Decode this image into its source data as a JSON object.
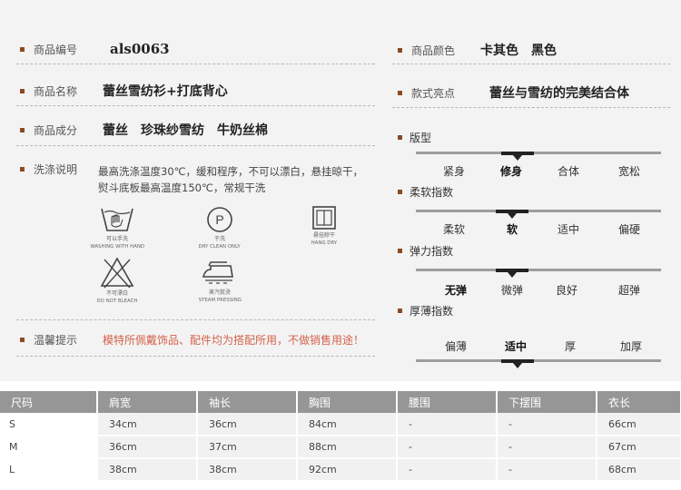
{
  "left": {
    "code": {
      "label": "商品编号",
      "value": "als0063"
    },
    "name": {
      "label": "商品名称",
      "value": "蕾丝雪纺衫+打底背心"
    },
    "material": {
      "label": "商品成分",
      "values": [
        "蕾丝",
        "珍珠纱雪纺",
        "牛奶丝棉"
      ]
    },
    "wash": {
      "label": "洗涤说明",
      "line1": "最高洗涤温度30℃，缓和程序，不可以漂白，悬挂晾干，",
      "line2": "熨斗底板最高温度150℃，常规干洗"
    },
    "warm": {
      "label": "温馨提示",
      "text": "模特所佩戴饰品、配件均为搭配所用，不做销售用途！"
    }
  },
  "care_icons": [
    {
      "icon": "hand-wash-icon",
      "cn": "可以手洗",
      "en": "WASHING WITH HAND"
    },
    {
      "icon": "dry-clean-icon",
      "cn": "干洗",
      "en": "DRY CLEAN ONLY"
    },
    {
      "icon": "hang-dry-icon",
      "cn": "悬挂晾干",
      "en": "HANG DRY"
    },
    {
      "icon": "no-bleach-icon",
      "cn": "不可漂白",
      "en": "DO NOT BLEACH"
    },
    {
      "icon": "steam-iron-icon",
      "cn": "蒸汽熨烫",
      "en": "STEAM PRESSING"
    }
  ],
  "right": {
    "color": {
      "label": "商品颜色",
      "values": [
        "卡其色",
        "黑色"
      ]
    },
    "highlight": {
      "label": "款式亮点",
      "value": "蕾丝与雪纺的完美结合体"
    }
  },
  "scales": [
    {
      "title": "版型",
      "options": [
        "紧身",
        "修身",
        "合体",
        "宽松"
      ],
      "selected": 1
    },
    {
      "title": "柔软指数",
      "options": [
        "柔软",
        "软",
        "适中",
        "偏硬"
      ],
      "selected": 1
    },
    {
      "title": "弹力指数",
      "options": [
        "无弹",
        "微弹",
        "良好",
        "超弹"
      ],
      "selected": 1
    },
    {
      "title": "厚薄指数",
      "options": [
        "偏薄",
        "适中",
        "厚",
        "加厚"
      ],
      "selected": 1
    }
  ],
  "size_table": {
    "headers": [
      "尺码",
      "肩宽",
      "袖长",
      "胸围",
      "腰围",
      "下摆围",
      "衣长"
    ],
    "rows": [
      [
        "S",
        "34cm",
        "36cm",
        "84cm",
        "-",
        "-",
        "66cm"
      ],
      [
        "M",
        "36cm",
        "37cm",
        "88cm",
        "-",
        "-",
        "67cm"
      ],
      [
        "L",
        "38cm",
        "38cm",
        "92cm",
        "-",
        "-",
        "68cm"
      ]
    ]
  },
  "colors": {
    "bullet": "#8a4a22",
    "warm_text": "#d4624b",
    "table_header": "#969696",
    "scale_bar": "#9d9d9d"
  }
}
